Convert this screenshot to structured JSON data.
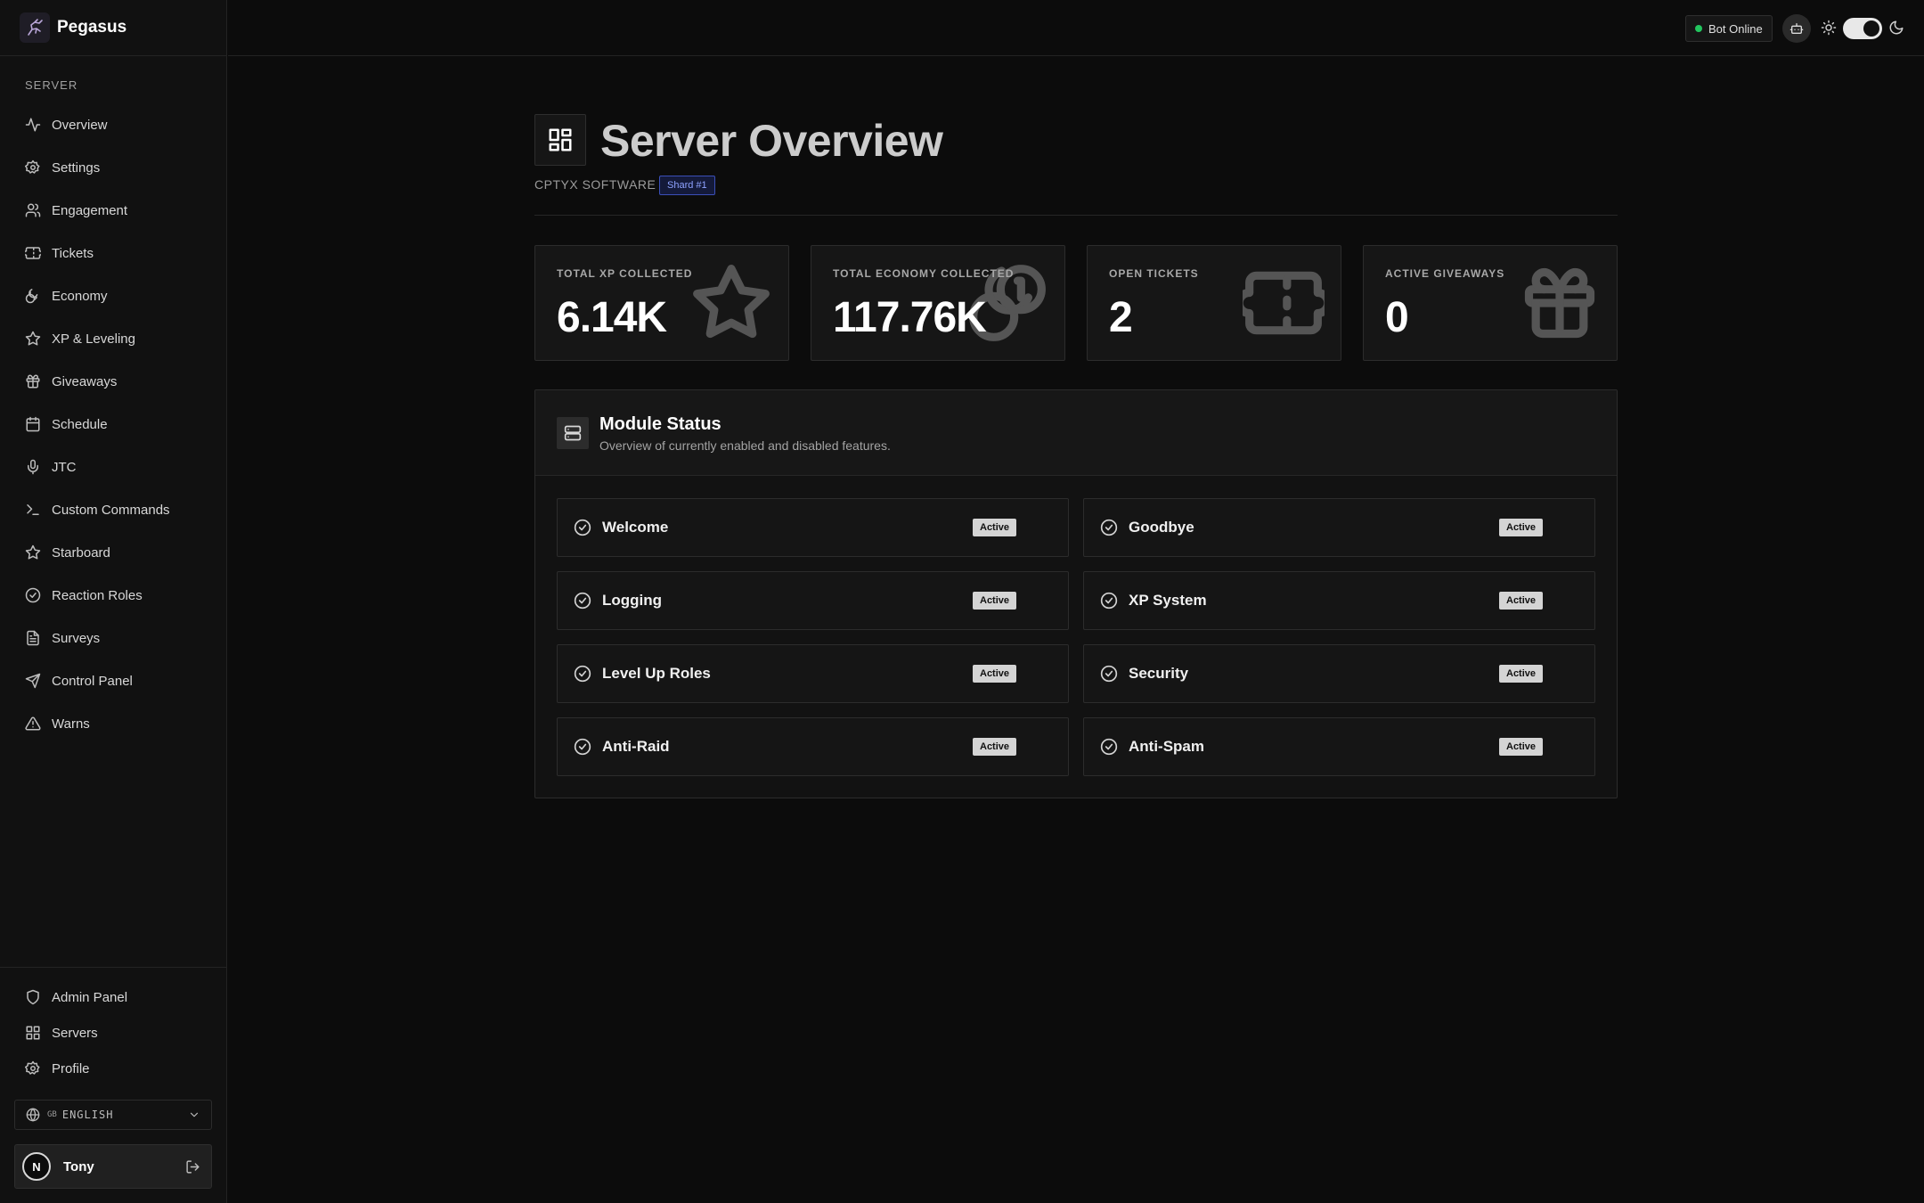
{
  "brand": {
    "name": "Pegasus",
    "logo_icon": "pegasus-logo"
  },
  "sidebar": {
    "section_label": "SERVER",
    "items": [
      {
        "label": "Overview",
        "icon": "activity-icon"
      },
      {
        "label": "Settings",
        "icon": "gear-icon"
      },
      {
        "label": "Engagement",
        "icon": "users-icon"
      },
      {
        "label": "Tickets",
        "icon": "ticket-icon"
      },
      {
        "label": "Economy",
        "icon": "coins-icon"
      },
      {
        "label": "XP & Leveling",
        "icon": "star-icon"
      },
      {
        "label": "Giveaways",
        "icon": "gift-icon"
      },
      {
        "label": "Schedule",
        "icon": "calendar-icon"
      },
      {
        "label": "JTC",
        "icon": "mic-icon"
      },
      {
        "label": "Custom Commands",
        "icon": "terminal-icon"
      },
      {
        "label": "Starboard",
        "icon": "star-icon"
      },
      {
        "label": "Reaction Roles",
        "icon": "check-circle-icon"
      },
      {
        "label": "Surveys",
        "icon": "file-text-icon"
      },
      {
        "label": "Control Panel",
        "icon": "send-icon"
      },
      {
        "label": "Warns",
        "icon": "warning-icon"
      }
    ],
    "bottom_items": [
      {
        "label": "Admin Panel",
        "icon": "shield-icon"
      },
      {
        "label": "Servers",
        "icon": "grid-icon"
      },
      {
        "label": "Profile",
        "icon": "gear-icon"
      }
    ],
    "language": {
      "flag": "GB",
      "label": "ENGLISH"
    },
    "user": {
      "name": "Tony",
      "avatar_initial": "N"
    }
  },
  "topbar": {
    "bot_status": "Bot Online",
    "status_color": "#22c55e"
  },
  "header": {
    "title": "Server Overview",
    "org": "CPTYX SOFTWARE",
    "shard": "Shard #1"
  },
  "stats": [
    {
      "label": "TOTAL XP COLLECTED",
      "value": "6.14K",
      "icon": "star-icon"
    },
    {
      "label": "TOTAL ECONOMY COLLECTED",
      "value": "117.76K",
      "icon": "coins-icon"
    },
    {
      "label": "OPEN TICKETS",
      "value": "2",
      "icon": "ticket-icon"
    },
    {
      "label": "ACTIVE GIVEAWAYS",
      "value": "0",
      "icon": "gift-icon"
    }
  ],
  "modules": {
    "title": "Module Status",
    "subtitle": "Overview of currently enabled and disabled features.",
    "items": [
      {
        "name": "Welcome",
        "status": "Active"
      },
      {
        "name": "Goodbye",
        "status": "Active"
      },
      {
        "name": "Logging",
        "status": "Active"
      },
      {
        "name": "XP System",
        "status": "Active"
      },
      {
        "name": "Level Up Roles",
        "status": "Active"
      },
      {
        "name": "Security",
        "status": "Active"
      },
      {
        "name": "Anti-Raid",
        "status": "Active"
      },
      {
        "name": "Anti-Spam",
        "status": "Active"
      }
    ]
  }
}
